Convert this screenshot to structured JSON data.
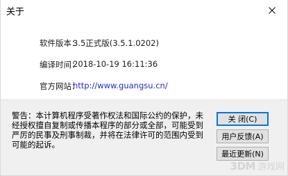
{
  "window": {
    "title": "关于"
  },
  "info": {
    "version_label": "软件版本：",
    "version_value": "3.5正式版(3.5.1.0202)",
    "build_label": "编译时间：",
    "build_value": "2018-10-19 16:11:36",
    "website_label": "官方网站：",
    "website_value": "http://www.guangsu.cn/"
  },
  "warning": {
    "text": "警告：本计算机程序受著作权法和国际公约的保护，未经授权擅自复制或传播本程序的部分或全部，可能受到严厉的民事及刑事制裁，并将在法律许可的范围内受到可能的起诉。"
  },
  "buttons": {
    "close_label": "关 闭(C)",
    "feedback_label": "用户反馈(A)",
    "update_label": "最近更新(N)"
  },
  "watermark": {
    "mark": "3DM",
    "text": "游戏网"
  },
  "colors": {
    "link": "#1f2dc8",
    "focus_border": "#0078d7",
    "panel_bg": "#f0f0f0"
  }
}
